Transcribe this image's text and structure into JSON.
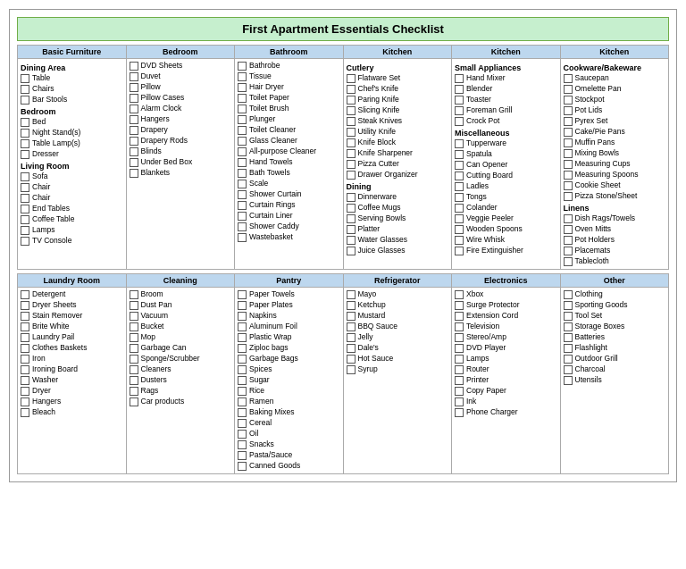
{
  "title": "First Apartment Essentials Checklist",
  "topSection": {
    "headers": [
      "Basic Furniture",
      "Bedroom",
      "Bathroom",
      "Kitchen",
      "Kitchen",
      "Kitchen"
    ],
    "columns": [
      {
        "sections": [
          {
            "title": "Dining Area",
            "items": [
              "Table",
              "Chairs",
              "Bar Stools"
            ]
          },
          {
            "title": "Bedroom",
            "items": [
              "Bed",
              "Night Stand(s)",
              "Table Lamp(s)",
              "Dresser"
            ]
          },
          {
            "title": "Living Room",
            "items": [
              "Sofa",
              "Chair",
              "Chair",
              "End Tables",
              "Coffee Table",
              "Lamps",
              "TV Console"
            ]
          }
        ]
      },
      {
        "sections": [
          {
            "title": "",
            "items": [
              "DVD Sheets",
              "Duvet",
              "Pillow",
              "Pillow Cases",
              "Alarm Clock",
              "Hangers",
              "Drapery",
              "Drapery Rods",
              "Blinds",
              "Under Bed Box",
              "Blankets"
            ]
          }
        ]
      },
      {
        "sections": [
          {
            "title": "",
            "items": [
              "Bathrobe",
              "Tissue",
              "Hair Dryer",
              "Toilet Paper",
              "Toilet Brush",
              "Plunger",
              "Toilet Cleaner",
              "Glass Cleaner",
              "All-purpose Cleaner",
              "Hand Towels",
              "Bath Towels",
              "Scale",
              "Shower Curtain",
              "Curtain Rings",
              "Curtain Liner",
              "Shower Caddy",
              "Wastebasket"
            ]
          }
        ]
      },
      {
        "sections": [
          {
            "title": "Cutlery",
            "items": [
              "Flatware Set",
              "Chef's Knife",
              "Paring Knife",
              "Slicing Knife",
              "Steak Knives",
              "Utility Knife",
              "Knife Block",
              "Knife Sharpener",
              "Pizza Cutter",
              "Drawer Organizer"
            ]
          },
          {
            "title": "Dining",
            "items": [
              "Dinnerware",
              "Coffee Mugs",
              "Serving Bowls",
              "Platter",
              "Water Glasses",
              "Juice Glasses"
            ]
          }
        ]
      },
      {
        "sections": [
          {
            "title": "Small Appliances",
            "items": [
              "Hand Mixer",
              "Blender",
              "Toaster",
              "Foreman Grill",
              "Crock Pot"
            ]
          },
          {
            "title": "Miscellaneous",
            "items": [
              "Tupperware",
              "Spatula",
              "Can Opener",
              "Cutting Board",
              "Ladles",
              "Tongs",
              "Colander",
              "Veggie Peeler",
              "Wooden Spoons",
              "Wire Whisk",
              "Fire Extinguisher"
            ]
          }
        ]
      },
      {
        "sections": [
          {
            "title": "Cookware/Bakeware",
            "items": [
              "Saucepan",
              "Omelette Pan",
              "Stockpot",
              "Pot Lids",
              "Pyrex Set",
              "Cake/Pie Pans",
              "Muffin Pans",
              "Mixing Bowls",
              "Measuring Cups",
              "Measuring Spoons",
              "Cookie Sheet",
              "Pizza Stone/Sheet"
            ]
          },
          {
            "title": "Linens",
            "items": [
              "Dish Rags/Towels",
              "Oven Mitts",
              "Pot Holders",
              "Placemats",
              "Tablecloth"
            ]
          }
        ]
      }
    ]
  },
  "bottomSection": {
    "headers": [
      "Laundry Room",
      "Cleaning",
      "Pantry",
      "Refrigerator",
      "Electronics",
      "Other"
    ],
    "columns": [
      {
        "items": [
          "Detergent",
          "Dryer Sheets",
          "Stain Remover",
          "Brite White",
          "Laundry Pail",
          "Clothes Baskets",
          "Iron",
          "Ironing Board",
          "Washer",
          "Dryer",
          "Hangers",
          "Bleach"
        ]
      },
      {
        "items": [
          "Broom",
          "Dust Pan",
          "Vacuum",
          "Bucket",
          "Mop",
          "Garbage Can",
          "Sponge/Scrubber",
          "Cleaners",
          "Dusters",
          "Rags",
          "Car products"
        ]
      },
      {
        "items": [
          "Paper Towels",
          "Paper Plates",
          "Napkins",
          "Aluminum Foil",
          "Plastic Wrap",
          "Ziploc bags",
          "Garbage Bags",
          "Spices",
          "Sugar",
          "Rice",
          "Ramen",
          "Baking Mixes",
          "Cereal",
          "Oil",
          "Snacks",
          "Pasta/Sauce",
          "Canned Goods"
        ]
      },
      {
        "items": [
          "Mayo",
          "Ketchup",
          "Mustard",
          "BBQ Sauce",
          "Jelly",
          "Dale's",
          "Hot Sauce",
          "Syrup"
        ]
      },
      {
        "items": [
          "Xbox",
          "Surge Protector",
          "Extension Cord",
          "Television",
          "Stereo/Amp",
          "DVD Player",
          "Lamps",
          "Router",
          "Printer",
          "Copy Paper",
          "Ink",
          "Phone Charger"
        ]
      },
      {
        "items": [
          "Clothing",
          "Sporting Goods",
          "Tool Set",
          "Storage Boxes",
          "Batteries",
          "Flashlight",
          "Outdoor Grill",
          "Charcoal",
          "Utensils"
        ]
      }
    ]
  }
}
